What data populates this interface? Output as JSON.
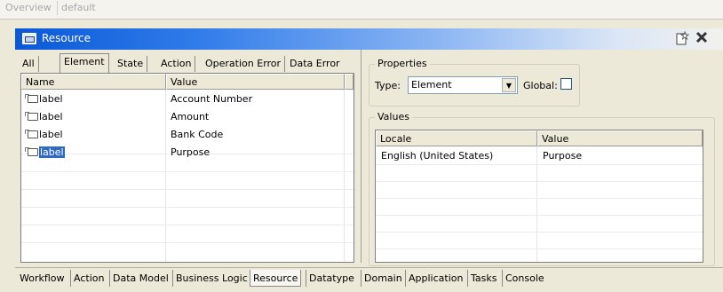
{
  "top_tabs": [
    "Overview",
    "default"
  ],
  "window": {
    "title": "Resource",
    "icon": "resource-window-icon",
    "buttons": [
      "new-icon",
      "close-icon"
    ]
  },
  "left_tabs": [
    "All",
    "Element",
    "State",
    "Action",
    "Operation Error",
    "Data Error"
  ],
  "left_active_tab": "Element",
  "element_table": {
    "columns": [
      "Name",
      "Value"
    ],
    "rows": [
      {
        "name": "label",
        "value": "Account Number",
        "icon": "label-icon"
      },
      {
        "name": "label",
        "value": "Amount",
        "icon": "label-icon"
      },
      {
        "name": "label",
        "value": "Bank Code",
        "icon": "label-icon"
      },
      {
        "name": "label",
        "value": "Purpose",
        "icon": "label-icon",
        "selected": true
      }
    ]
  },
  "properties": {
    "group_title": "Properties",
    "type_label": "Type:",
    "type_value": "Element",
    "global_label": "Global:",
    "global_checked": false
  },
  "values": {
    "group_title": "Values",
    "columns": [
      "Locale",
      "Value"
    ],
    "rows": [
      {
        "locale": "English (United States)",
        "value": "Purpose"
      }
    ]
  },
  "bottom_tabs": [
    "Workflow",
    "Action",
    "Data Model",
    "Business Logic",
    "Resource",
    "Datatype",
    "Domain",
    "Application",
    "Tasks",
    "Console"
  ],
  "bottom_active_tab": "Resource",
  "colors": {
    "title_bar_start": "#0a58d6",
    "selection": "#316ac5",
    "window_bg": "#ece9d8"
  }
}
